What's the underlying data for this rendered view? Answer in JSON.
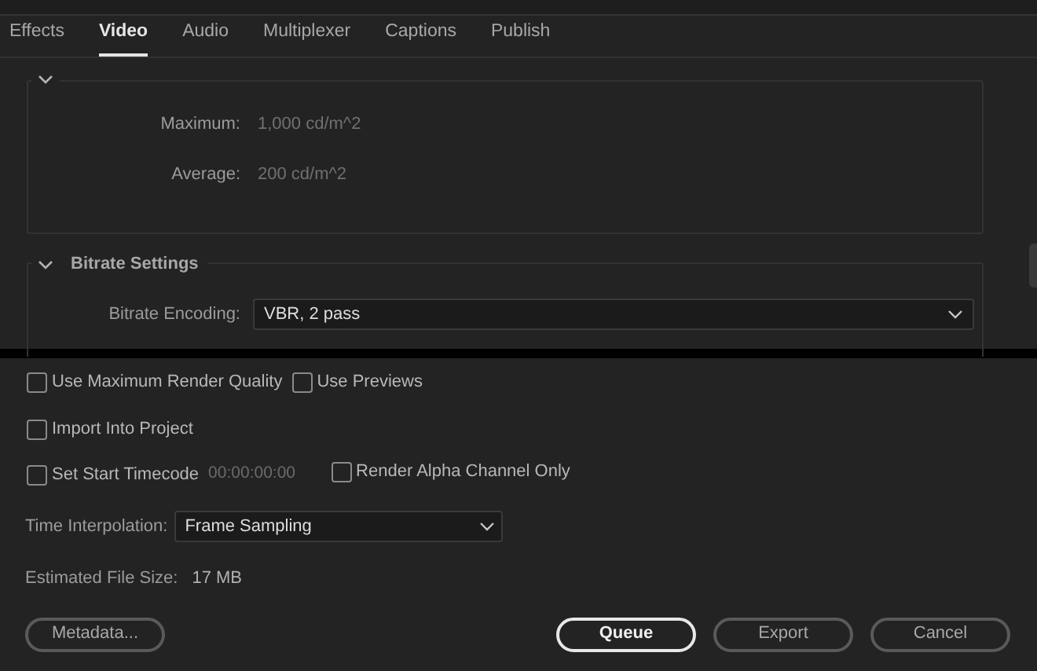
{
  "tabs": [
    {
      "label": "Effects",
      "selected": false
    },
    {
      "label": "Video",
      "selected": true
    },
    {
      "label": "Audio",
      "selected": false
    },
    {
      "label": "Multiplexer",
      "selected": false
    },
    {
      "label": "Captions",
      "selected": false
    },
    {
      "label": "Publish",
      "selected": false
    }
  ],
  "luminance_section": {
    "expanded": true,
    "fields": [
      {
        "label": "Maximum:",
        "value": "1,000 cd/m^2",
        "disabled": true
      },
      {
        "label": "Average:",
        "value": "200 cd/m^2",
        "disabled": true
      }
    ]
  },
  "bitrate_section": {
    "title": "Bitrate Settings",
    "expanded": true,
    "encoding": {
      "label": "Bitrate Encoding:",
      "value": "VBR, 2 pass"
    }
  },
  "options": {
    "use_max_render_quality": {
      "label": "Use Maximum Render Quality",
      "checked": false
    },
    "use_previews": {
      "label": "Use Previews",
      "checked": false
    },
    "import_into_project": {
      "label": "Import Into Project",
      "checked": false
    },
    "set_start_timecode": {
      "label": "Set Start Timecode",
      "checked": false,
      "timecode": "00:00:00:00"
    },
    "render_alpha_only": {
      "label": "Render Alpha Channel Only",
      "checked": false
    }
  },
  "time_interpolation": {
    "label": "Time Interpolation:",
    "value": "Frame Sampling"
  },
  "estimated_file_size": {
    "label": "Estimated File Size:",
    "value": "17 MB"
  },
  "buttons": [
    {
      "label": "Metadata...",
      "kind": "default"
    },
    {
      "label": "Queue",
      "kind": "primary"
    },
    {
      "label": "Export",
      "kind": "default"
    },
    {
      "label": "Cancel",
      "kind": "default"
    }
  ]
}
